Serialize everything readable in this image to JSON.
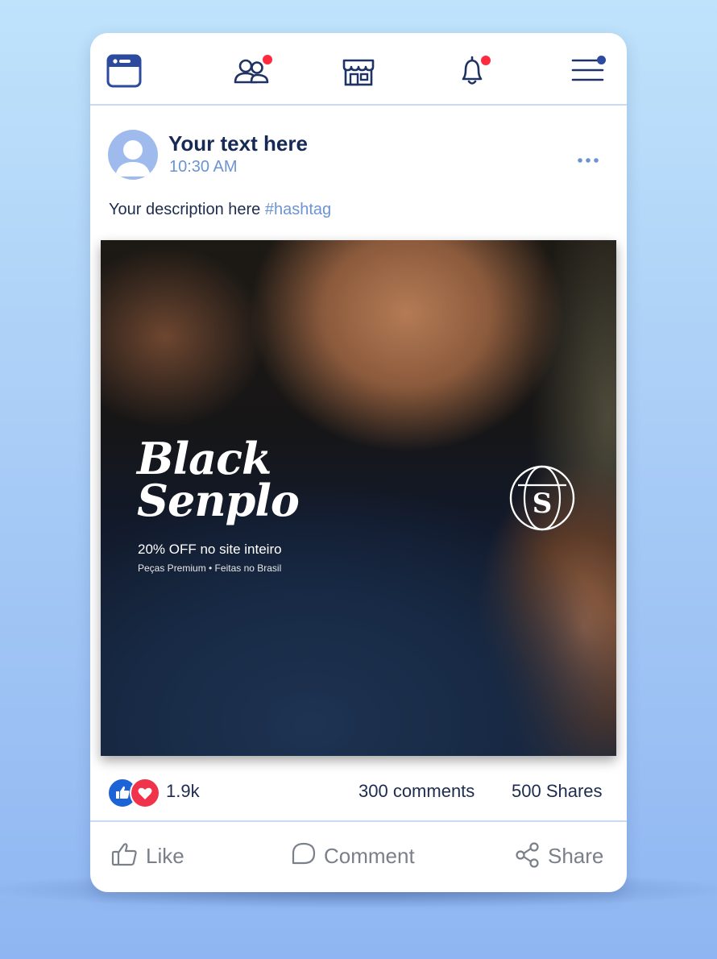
{
  "nav": {
    "icons": [
      "browser-icon",
      "friends-icon",
      "marketplace-icon",
      "notifications-icon",
      "menu-icon"
    ],
    "accent_color": "#2c4a9e",
    "badge_color": "#ff2a3d"
  },
  "post": {
    "author": "Your text here",
    "time": "10:30 AM",
    "description": "Your description here",
    "hashtag": "#hashtag"
  },
  "image": {
    "title_line1": "Black",
    "title_line2": "Senplo",
    "offer": "20% OFF no site inteiro",
    "subtitle": "Peças Premium • Feitas no Brasil",
    "logo_letter": "S"
  },
  "stats": {
    "reactions_count": "1.9k",
    "comments": "300 comments",
    "shares": "500 Shares",
    "like_color": "#1b63d6",
    "love_color": "#f0324b"
  },
  "actions": {
    "like": "Like",
    "comment": "Comment",
    "share": "Share"
  }
}
